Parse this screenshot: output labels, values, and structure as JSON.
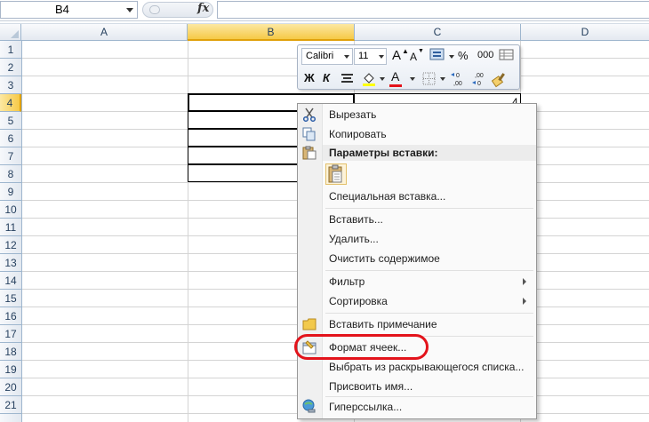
{
  "formula_bar": {
    "name_box_value": "B4",
    "fx_label": "fx",
    "formula_value": ""
  },
  "columns": [
    {
      "label": "A",
      "selected": false
    },
    {
      "label": "B",
      "selected": true
    },
    {
      "label": "C",
      "selected": false
    },
    {
      "label": "D",
      "selected": false
    }
  ],
  "rows": [
    "1",
    "2",
    "3",
    "4",
    "5",
    "6",
    "7",
    "8",
    "9",
    "10",
    "11",
    "12",
    "13",
    "14",
    "15",
    "16",
    "17",
    "18",
    "19",
    "20",
    "21"
  ],
  "selected_row": "4",
  "cells": {
    "c4_value": "4"
  },
  "mini_toolbar": {
    "font_name": "Calibri",
    "font_size": "11",
    "bold": "Ж",
    "italic": "К",
    "percent": "%",
    "thousands": "000",
    "font_color_letter": "A",
    "grow_letter": "A",
    "shrink_letter": "A",
    "accent_color": "#e3131b"
  },
  "context_menu": {
    "cut": "Вырезать",
    "copy": "Копировать",
    "paste_options_header": "Параметры вставки:",
    "paste_special": "Специальная вставка...",
    "insert": "Вставить...",
    "delete": "Удалить...",
    "clear_contents": "Очистить содержимое",
    "filter": "Фильтр",
    "sort": "Сортировка",
    "insert_comment": "Вставить примечание",
    "format_cells": "Формат ячеек...",
    "pick_from_list": "Выбрать из раскрывающегося списка...",
    "define_name": "Присвоить имя...",
    "hyperlink": "Гиперссылка..."
  },
  "highlight_color": "#e3131b"
}
